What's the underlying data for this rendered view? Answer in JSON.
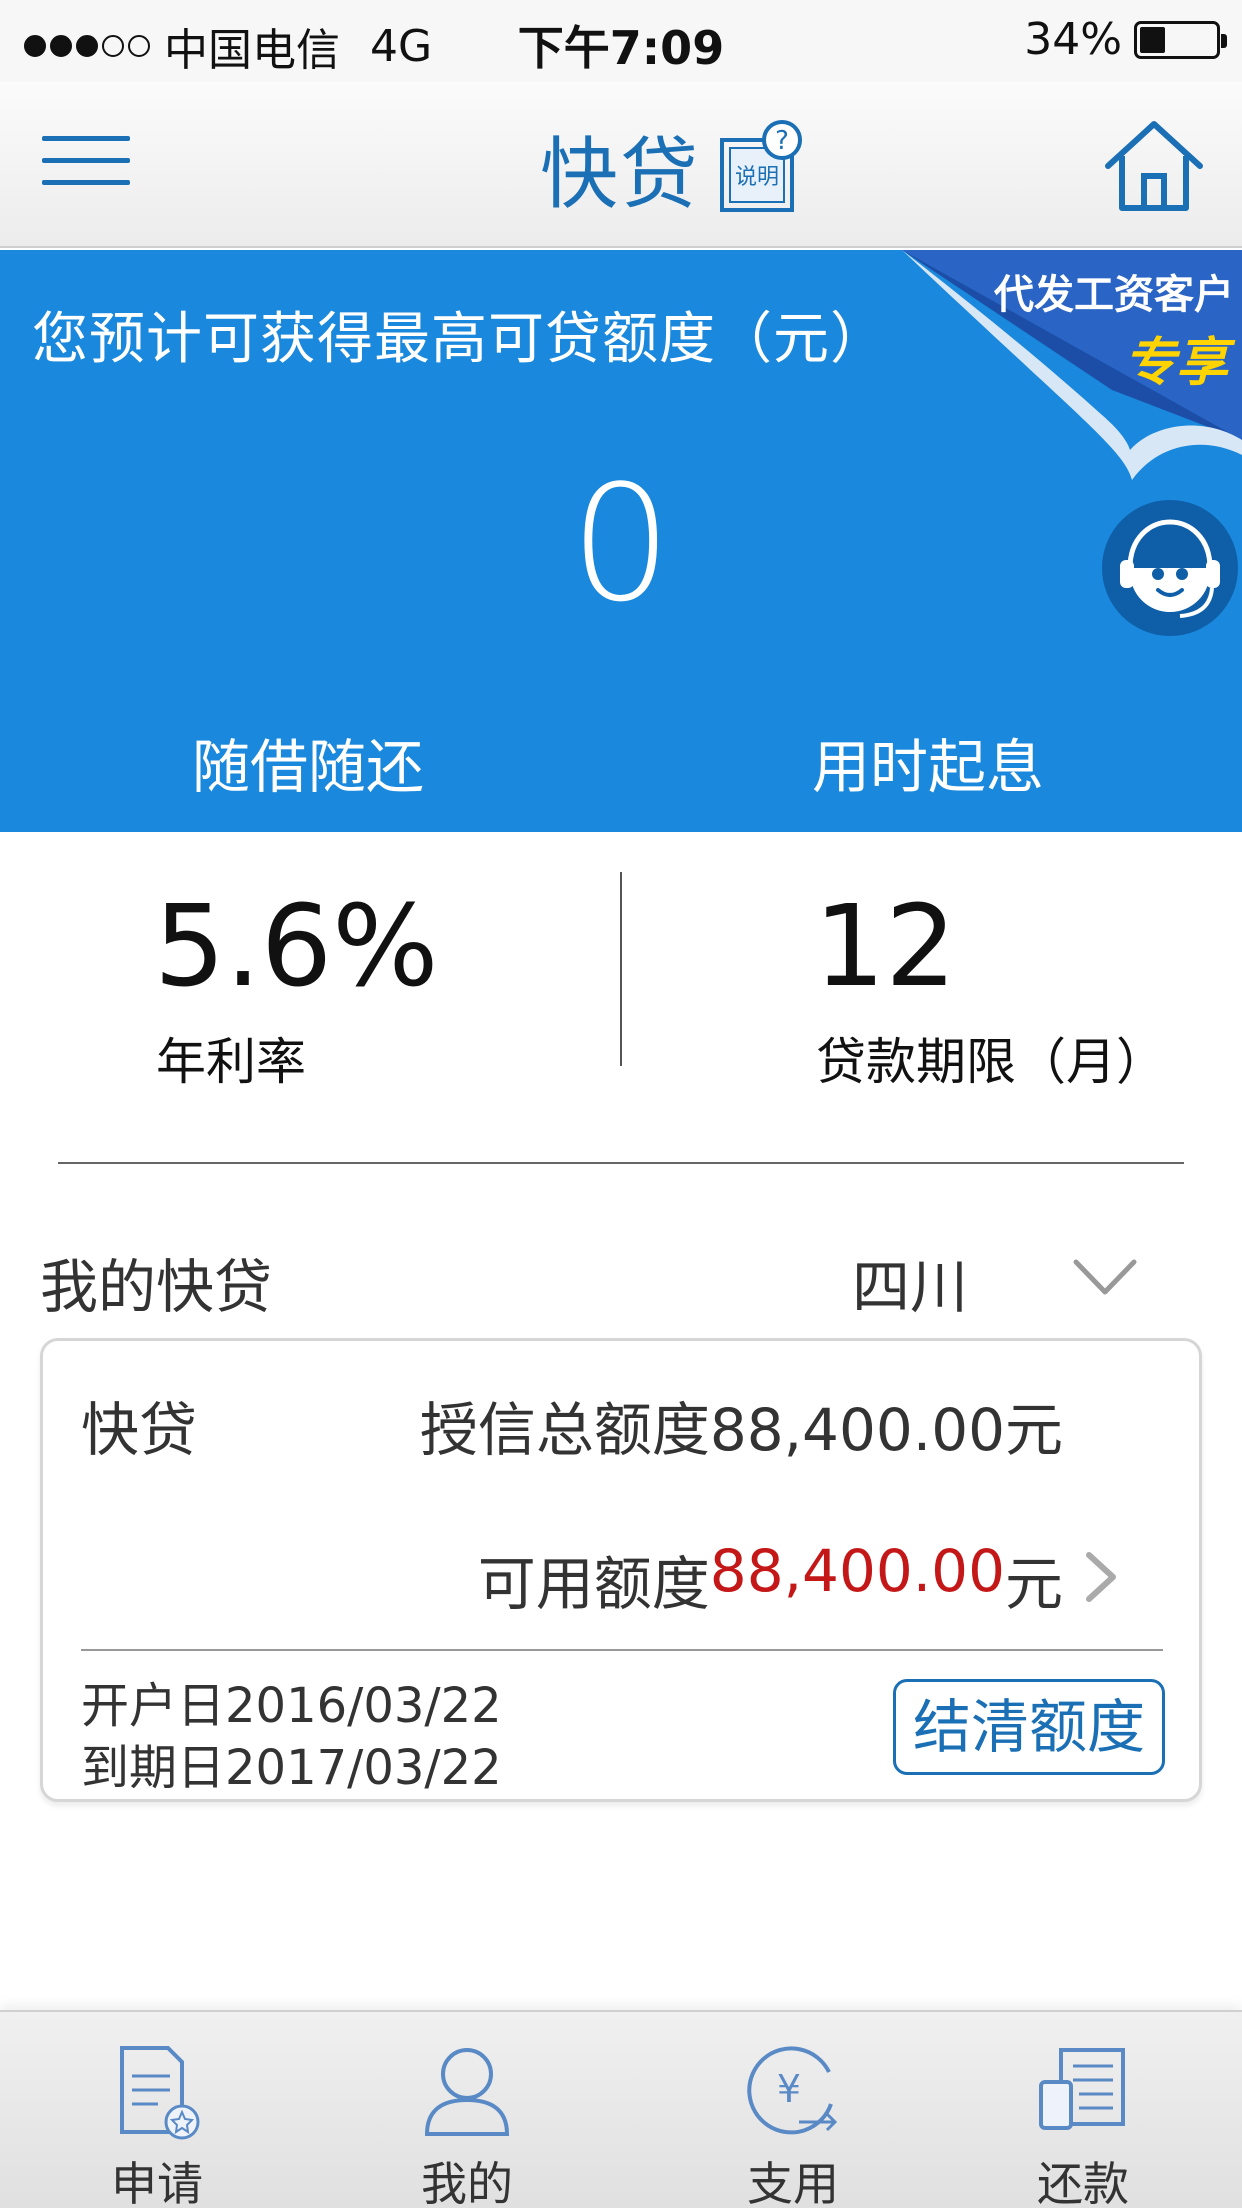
{
  "status_bar": {
    "carrier": "中国电信",
    "network": "4G",
    "time": "下午7:09",
    "battery": "34%",
    "battery_level": 0.34,
    "signal_strength": 3,
    "signal_max": 5
  },
  "nav": {
    "title": "快贷",
    "help_label": "说明",
    "menu_icon": "menu-icon",
    "home_icon": "home-icon",
    "accent_color": "#1a6fb5"
  },
  "hero": {
    "caption": "您预计可获得最高可贷额度（元）",
    "amount": "0",
    "ribbon_line1": "代发工资客户",
    "ribbon_line2": "专享",
    "feature_left": "随借随还",
    "feature_right": "用时起息",
    "background_color": "#1a88dc"
  },
  "stats": {
    "rate_value": "5.6%",
    "rate_label": "年利率",
    "term_value": "12",
    "term_label": "贷款期限（月）"
  },
  "my_loans": {
    "section_title": "我的快贷",
    "region": "四川",
    "card": {
      "product": "快贷",
      "total_label": "授信总额度88,400.00元",
      "available_prefix": "可用额度",
      "available_amount": "88,400.00",
      "available_suffix": "元",
      "open_date": "开户日2016/03/22",
      "expire_date": "到期日2017/03/22",
      "settle_button": "结清额度"
    }
  },
  "tabs": [
    {
      "label": "申请",
      "icon": "apply-document-icon"
    },
    {
      "label": "我的",
      "icon": "user-profile-icon"
    },
    {
      "label": "支用",
      "icon": "yuan-withdraw-icon"
    },
    {
      "label": "还款",
      "icon": "repay-ledger-icon"
    }
  ]
}
